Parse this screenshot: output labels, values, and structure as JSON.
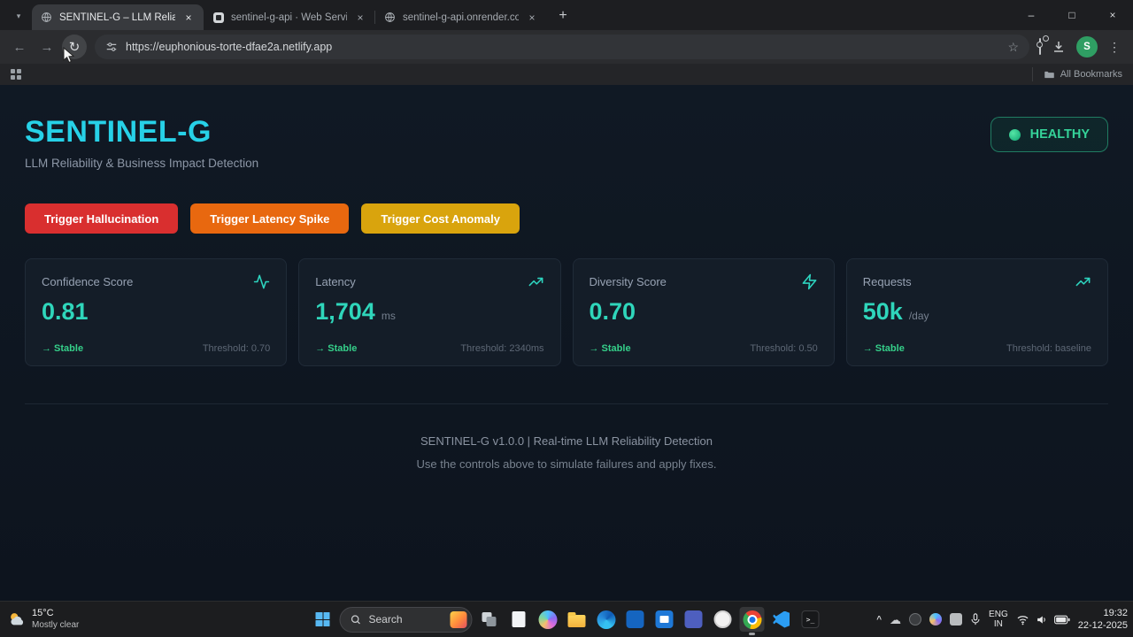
{
  "browser": {
    "window_controls": {
      "minimize": "–",
      "maximize": "□",
      "close": "×"
    },
    "tab_strip": {
      "search_chevron": "▾",
      "new_tab_glyph": "+",
      "tab_close_glyph": "×"
    },
    "tabs": [
      {
        "title": "SENTINEL-G – LLM Reliability D"
      },
      {
        "title": "sentinel-g-api · Web Service ·"
      },
      {
        "title": "sentinel-g-api.onrender.com"
      }
    ],
    "nav": {
      "back": "←",
      "forward": "→",
      "reload": "↻"
    },
    "omnibox": {
      "url": "https://euphonious-torte-dfae2a.netlify.app",
      "star": "☆"
    },
    "toolbar": {
      "menu_glyph": "⋮",
      "profile_initial": "S"
    },
    "bookmarks_bar": {
      "all_bookmarks_label": "All Bookmarks"
    }
  },
  "page": {
    "title": "SENTINEL-G",
    "subtitle": "LLM Reliability & Business Impact Detection",
    "status": {
      "label": "HEALTHY"
    },
    "triggers": [
      {
        "label": "Trigger Hallucination",
        "color": "#d92f2f"
      },
      {
        "label": "Trigger Latency Spike",
        "color": "#e8680f"
      },
      {
        "label": "Trigger Cost Anomaly",
        "color": "#d9a40d"
      }
    ],
    "cards": [
      {
        "title": "Confidence Score",
        "value": "0.81",
        "unit": "",
        "trend": "→ Stable",
        "threshold": "Threshold: 0.70",
        "icon": "activity-icon"
      },
      {
        "title": "Latency",
        "value": "1,704",
        "unit": "ms",
        "trend": "→ Stable",
        "threshold": "Threshold: 2340ms",
        "icon": "trending-up-icon"
      },
      {
        "title": "Diversity Score",
        "value": "0.70",
        "unit": "",
        "trend": "→ Stable",
        "threshold": "Threshold: 0.50",
        "icon": "zap-icon"
      },
      {
        "title": "Requests",
        "value": "50k",
        "unit": "/day",
        "trend": "→ Stable",
        "threshold": "Threshold: baseline",
        "icon": "trending-up-icon"
      }
    ],
    "footer": {
      "line1": "SENTINEL-G v1.0.0 | Real-time LLM Reliability Detection",
      "line2": "Use the controls above to simulate failures and apply fixes."
    },
    "colors": {
      "accent_cyan": "#27d1e7",
      "metric_teal": "#2dd4bf",
      "healthy_green": "#34d399",
      "background": "#0e1621",
      "card_background": "#141d28"
    }
  },
  "taskbar": {
    "weather": {
      "temp": "15°C",
      "condition": "Mostly clear"
    },
    "search_label": "Search",
    "tray_chevron": "^",
    "cloud_glyph": "☁",
    "language": {
      "line1": "ENG",
      "line2": "IN"
    },
    "clock": {
      "time": "19:32",
      "date": "22-12-2025"
    }
  }
}
